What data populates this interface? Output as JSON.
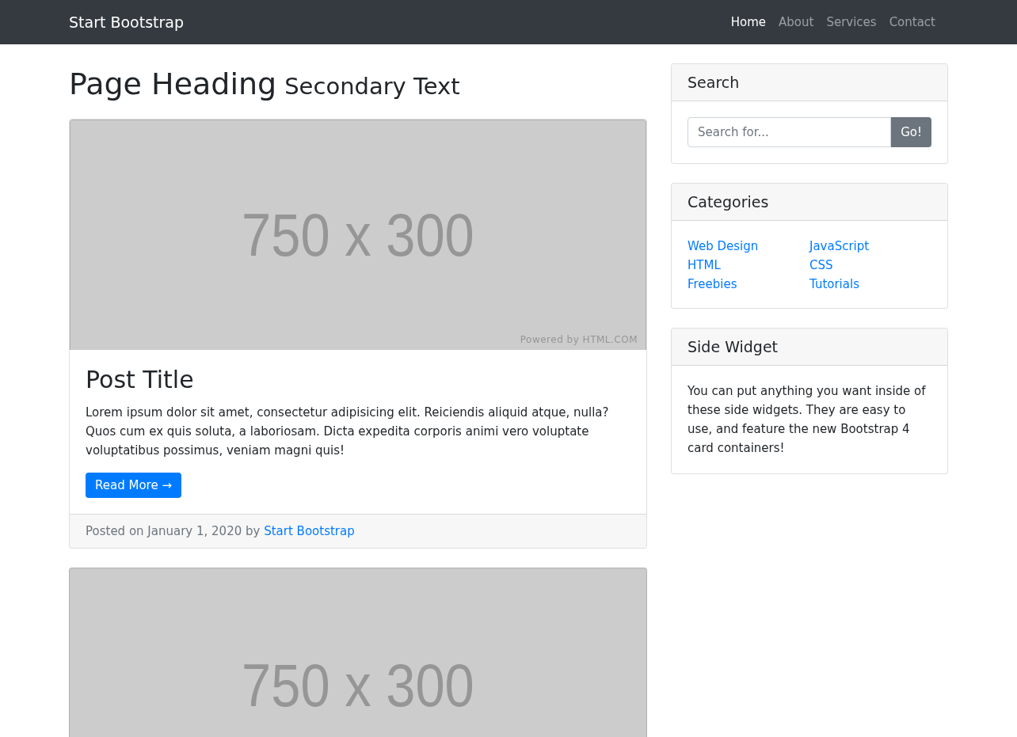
{
  "navbar": {
    "brand": "Start Bootstrap",
    "links": [
      {
        "label": "Home",
        "selected": true
      },
      {
        "label": "About",
        "selected": false
      },
      {
        "label": "Services",
        "selected": false
      },
      {
        "label": "Contact",
        "selected": false
      }
    ]
  },
  "heading": {
    "title": "Page Heading",
    "subtitle": "Secondary Text"
  },
  "posts": [
    {
      "image": {
        "text": "750 x 300",
        "credit": "Powered by HTML.COM"
      },
      "title": "Post Title",
      "body": "Lorem ipsum dolor sit amet, consectetur adipisicing elit. Reiciendis aliquid atque, nulla? Quos cum ex quis soluta, a laboriosam. Dicta expedita corporis animi vero voluptate voluptatibus possimus, veniam magni quis!",
      "button": "Read More →",
      "footer": {
        "prefix": "Posted on January 1, 2020 by",
        "author": "Start Bootstrap"
      }
    },
    {
      "image": {
        "text": "750 x 300"
      }
    }
  ],
  "sidebar": {
    "search": {
      "title": "Search",
      "placeholder": "Search for...",
      "button": "Go!"
    },
    "categories": {
      "title": "Categories",
      "columns": [
        [
          "Web Design",
          "HTML",
          "Freebies"
        ],
        [
          "JavaScript",
          "CSS",
          "Tutorials"
        ]
      ]
    },
    "widget": {
      "title": "Side Widget",
      "text": "You can put anything you want inside of these side widgets. They are easy to use, and feature the new Bootstrap 4 card containers!"
    }
  }
}
